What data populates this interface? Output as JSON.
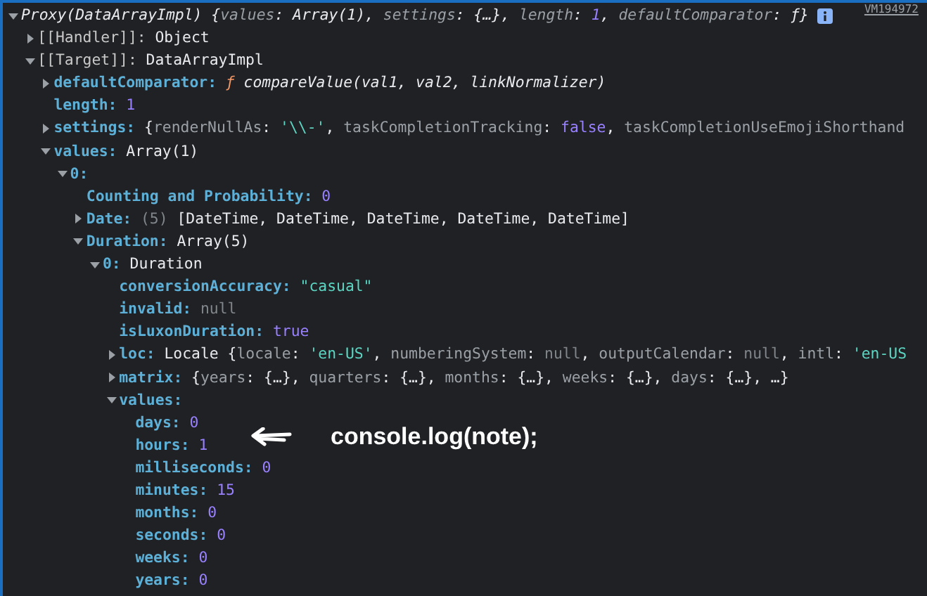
{
  "source_link": "VM194972",
  "tree": {
    "kind": "preview",
    "expanded": true,
    "parts": [
      {
        "text": "Proxy(DataArrayImpl)",
        "kind": "plain"
      },
      {
        "text": " {",
        "kind": "plain"
      },
      {
        "text": "values",
        "kind": "dim"
      },
      {
        "text": ": Array(1), ",
        "kind": "plain"
      },
      {
        "text": "settings",
        "kind": "dim"
      },
      {
        "text": ": {…}, ",
        "kind": "plain"
      },
      {
        "text": "length",
        "kind": "dim"
      },
      {
        "text": ": ",
        "kind": "plain"
      },
      {
        "text": "1",
        "kind": "number"
      },
      {
        "text": ", ",
        "kind": "plain"
      },
      {
        "text": "defaultComparator",
        "kind": "dim"
      },
      {
        "text": ": ƒ}",
        "kind": "plain"
      }
    ],
    "info_badge": true,
    "children": [
      {
        "kind": "internal",
        "key": "[[Handler]]:",
        "expanded": false,
        "parts": [
          {
            "text": "Object",
            "kind": "plain"
          }
        ]
      },
      {
        "kind": "internal",
        "key": "[[Target]]:",
        "expanded": true,
        "parts": [
          {
            "text": "DataArrayImpl",
            "kind": "plain"
          }
        ],
        "children": [
          {
            "kind": "property",
            "key": "defaultComparator:",
            "expanded": false,
            "parts": [
              {
                "text": "ƒ",
                "kind": "function"
              },
              {
                "text": " compareValue(val1, val2, linkNormalizer)",
                "kind": "signature"
              }
            ]
          },
          {
            "kind": "property",
            "key": "length:",
            "parts": [
              {
                "text": "1",
                "kind": "number"
              }
            ]
          },
          {
            "kind": "property",
            "key": "settings:",
            "expanded": false,
            "parts": [
              {
                "text": "{",
                "kind": "plain"
              },
              {
                "text": "renderNullAs",
                "kind": "dim"
              },
              {
                "text": ": ",
                "kind": "plain"
              },
              {
                "text": "'\\\\-'",
                "kind": "string"
              },
              {
                "text": ", ",
                "kind": "plain"
              },
              {
                "text": "taskCompletionTracking",
                "kind": "dim"
              },
              {
                "text": ": ",
                "kind": "plain"
              },
              {
                "text": "false",
                "kind": "keyword"
              },
              {
                "text": ", ",
                "kind": "plain"
              },
              {
                "text": "taskCompletionUseEmojiShorthand",
                "kind": "dim"
              }
            ]
          },
          {
            "kind": "property",
            "key": "values:",
            "expanded": true,
            "parts": [
              {
                "text": "Array(1)",
                "kind": "plain"
              }
            ],
            "children": [
              {
                "kind": "property",
                "key": "0:",
                "expanded": true,
                "children": [
                  {
                    "kind": "property",
                    "key": "Counting and Probability:",
                    "parts": [
                      {
                        "text": "0",
                        "kind": "number"
                      }
                    ]
                  },
                  {
                    "kind": "property",
                    "key": "Date:",
                    "expanded": false,
                    "parts": [
                      {
                        "text": "(5)",
                        "kind": "null"
                      },
                      {
                        "text": " [DateTime, DateTime, DateTime, DateTime, DateTime]",
                        "kind": "plain"
                      }
                    ]
                  },
                  {
                    "kind": "property",
                    "key": "Duration:",
                    "expanded": true,
                    "parts": [
                      {
                        "text": "Array(5)",
                        "kind": "plain"
                      }
                    ],
                    "children": [
                      {
                        "kind": "property",
                        "key": "0:",
                        "expanded": true,
                        "parts": [
                          {
                            "text": "Duration",
                            "kind": "plain"
                          }
                        ],
                        "children": [
                          {
                            "kind": "property",
                            "key": "conversionAccuracy:",
                            "parts": [
                              {
                                "text": "\"casual\"",
                                "kind": "string"
                              }
                            ]
                          },
                          {
                            "kind": "property",
                            "key": "invalid:",
                            "parts": [
                              {
                                "text": "null",
                                "kind": "null"
                              }
                            ]
                          },
                          {
                            "kind": "property",
                            "key": "isLuxonDuration:",
                            "parts": [
                              {
                                "text": "true",
                                "kind": "keyword"
                              }
                            ]
                          },
                          {
                            "kind": "property",
                            "key": "loc:",
                            "expanded": false,
                            "parts": [
                              {
                                "text": "Locale {",
                                "kind": "plain"
                              },
                              {
                                "text": "locale",
                                "kind": "dim"
                              },
                              {
                                "text": ": ",
                                "kind": "plain"
                              },
                              {
                                "text": "'en-US'",
                                "kind": "string"
                              },
                              {
                                "text": ", ",
                                "kind": "plain"
                              },
                              {
                                "text": "numberingSystem",
                                "kind": "dim"
                              },
                              {
                                "text": ": ",
                                "kind": "plain"
                              },
                              {
                                "text": "null",
                                "kind": "null"
                              },
                              {
                                "text": ", ",
                                "kind": "plain"
                              },
                              {
                                "text": "outputCalendar",
                                "kind": "dim"
                              },
                              {
                                "text": ": ",
                                "kind": "plain"
                              },
                              {
                                "text": "null",
                                "kind": "null"
                              },
                              {
                                "text": ", ",
                                "kind": "plain"
                              },
                              {
                                "text": "intl",
                                "kind": "dim"
                              },
                              {
                                "text": ": ",
                                "kind": "plain"
                              },
                              {
                                "text": "'en-US",
                                "kind": "string"
                              }
                            ]
                          },
                          {
                            "kind": "property",
                            "key": "matrix:",
                            "expanded": false,
                            "parts": [
                              {
                                "text": "{",
                                "kind": "plain"
                              },
                              {
                                "text": "years",
                                "kind": "dim"
                              },
                              {
                                "text": ": {…}, ",
                                "kind": "plain"
                              },
                              {
                                "text": "quarters",
                                "kind": "dim"
                              },
                              {
                                "text": ": {…}, ",
                                "kind": "plain"
                              },
                              {
                                "text": "months",
                                "kind": "dim"
                              },
                              {
                                "text": ": {…}, ",
                                "kind": "plain"
                              },
                              {
                                "text": "weeks",
                                "kind": "dim"
                              },
                              {
                                "text": ": {…}, ",
                                "kind": "plain"
                              },
                              {
                                "text": "days",
                                "kind": "dim"
                              },
                              {
                                "text": ": {…}, …}",
                                "kind": "plain"
                              }
                            ]
                          },
                          {
                            "kind": "property",
                            "key": "values:",
                            "expanded": true,
                            "children": [
                              {
                                "kind": "property",
                                "key": "days:",
                                "parts": [
                                  {
                                    "text": "0",
                                    "kind": "number"
                                  }
                                ]
                              },
                              {
                                "kind": "property",
                                "key": "hours:",
                                "parts": [
                                  {
                                    "text": "1",
                                    "kind": "number"
                                  }
                                ]
                              },
                              {
                                "kind": "property",
                                "key": "milliseconds:",
                                "parts": [
                                  {
                                    "text": "0",
                                    "kind": "number"
                                  }
                                ]
                              },
                              {
                                "kind": "property",
                                "key": "minutes:",
                                "parts": [
                                  {
                                    "text": "15",
                                    "kind": "number"
                                  }
                                ]
                              },
                              {
                                "kind": "property",
                                "key": "months:",
                                "parts": [
                                  {
                                    "text": "0",
                                    "kind": "number"
                                  }
                                ]
                              },
                              {
                                "kind": "property",
                                "key": "seconds:",
                                "parts": [
                                  {
                                    "text": "0",
                                    "kind": "number"
                                  }
                                ]
                              },
                              {
                                "kind": "property",
                                "key": "weeks:",
                                "parts": [
                                  {
                                    "text": "0",
                                    "kind": "number"
                                  }
                                ]
                              },
                              {
                                "kind": "property",
                                "key": "years:",
                                "parts": [
                                  {
                                    "text": "0",
                                    "kind": "number"
                                  }
                                ]
                              }
                            ]
                          }
                        ]
                      }
                    ]
                  }
                ]
              }
            ]
          }
        ]
      }
    ]
  },
  "annotation": {
    "text": "console.log(note);"
  }
}
